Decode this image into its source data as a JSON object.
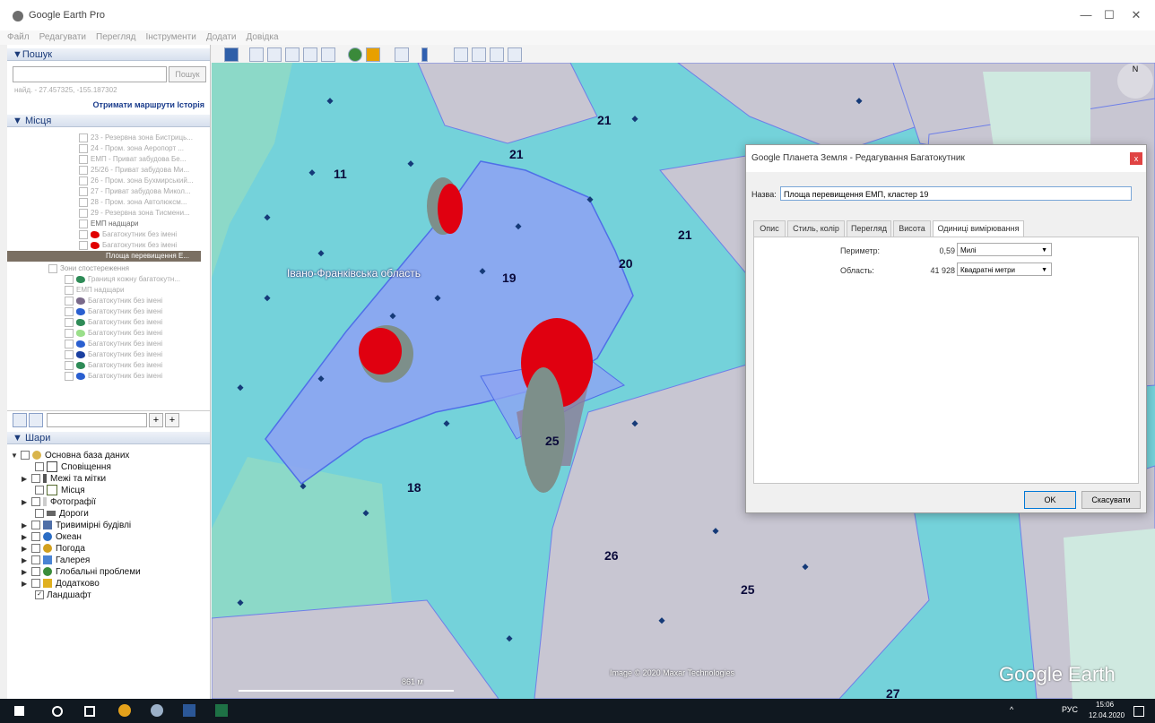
{
  "window": {
    "title": "Google Earth Pro",
    "minimize": "—",
    "maximize": "☐",
    "close": "✕"
  },
  "menu": [
    "Файл",
    "Редагувати",
    "Перегляд",
    "Інструменти",
    "Додати",
    "Довідка"
  ],
  "search": {
    "header": "▼Пошук",
    "button": "Пошук",
    "coords": "найд. - 27.457325, -155.187302",
    "routes": "Отримати маршрути",
    "history": "Історія"
  },
  "places": {
    "header": "▼ Місця",
    "items": [
      "23 - Резервна зона Бистриць...",
      "24 - Пром. зона Аеропорт ...",
      "ЕМП - Приват забудова Бе...",
      "25/26 - Приват забудова Ми...",
      "26 - Пром. зона Бухмирський...",
      "27 - Приват забудова Микол...",
      "28 - Пром. зона Автолюксм...",
      "29 - Резервна зона Тисмени...",
      "ЕМП надщари",
      "Багатокутник без імені",
      "Багатокутник без імені"
    ],
    "selected": "Площа перевищення Е...",
    "folder": "Зони спостереження",
    "subitems": [
      "Границя кожну багатокутн...",
      "ЕМП надщари",
      "Багатокутник без імені",
      "Багатокутник без імені",
      "Багатокутник без імені",
      "Багатокутник без імені",
      "Багатокутник без імені",
      "Багатокутник без імені",
      "Багатокутник без імені",
      "Багатокутник без імені"
    ]
  },
  "layers": {
    "header": "▼ Шари",
    "items": [
      {
        "label": "Основна база даних",
        "color": "#d9b44a"
      },
      {
        "label": "Сповіщення",
        "color": "#444"
      },
      {
        "label": "Межі та мітки",
        "color": "#555"
      },
      {
        "label": "Місця",
        "color": "#556b2f"
      },
      {
        "label": "Фотографії",
        "color": "#999"
      },
      {
        "label": "Дороги",
        "color": "#666"
      },
      {
        "label": "Тривимірні будівлі",
        "color": "#4f6fa8"
      },
      {
        "label": "Океан",
        "color": "#2a6cc4"
      },
      {
        "label": "Погода",
        "color": "#d2a01e"
      },
      {
        "label": "Галерея",
        "color": "#4a84d4"
      },
      {
        "label": "Глобальні проблеми",
        "color": "#3a8d3a"
      },
      {
        "label": "Додатково",
        "color": "#e0b020"
      },
      {
        "label": "Ландшафт",
        "color": "#777"
      }
    ]
  },
  "map": {
    "labels": [
      "11",
      "21",
      "21",
      "21",
      "20",
      "19",
      "18",
      "25",
      "26",
      "25",
      "27"
    ],
    "region": "Івано-Франківська область",
    "scale": "861 м",
    "attribution": "Image © 2020 Maxar Technologies",
    "brand": "Google Earth",
    "compass": "N"
  },
  "dialog": {
    "title": "Google Планета Земля - Редагування Багатокутник",
    "close": "x",
    "name_label": "Назва:",
    "name_value": "Площа перевищення ЕМП, кластер 19",
    "tabs": [
      "Опис",
      "Стиль, колір",
      "Перегляд",
      "Висота",
      "Одиниці вимірювання"
    ],
    "perimeter_label": "Периметр:",
    "perimeter_value": "0,59",
    "perimeter_unit": "Милі",
    "area_label": "Область:",
    "area_value": "41 928",
    "area_unit": "Квадратні метри",
    "ok": "OK",
    "cancel": "Скасувати"
  },
  "taskbar": {
    "lang": "РУС",
    "time": "15:06",
    "date": "12.04.2020",
    "tray_arrow": "^"
  }
}
